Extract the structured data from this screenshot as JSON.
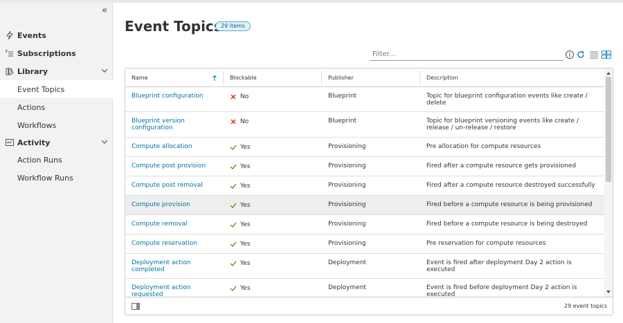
{
  "sidebar": {
    "collapse_label": "«",
    "items": [
      {
        "label": "Events",
        "icon": "bolt-icon",
        "type": "group"
      },
      {
        "label": "Subscriptions",
        "icon": "subscriptions-icon",
        "type": "group"
      },
      {
        "label": "Library",
        "icon": "library-icon",
        "type": "group",
        "expandable": true
      },
      {
        "label": "Event Topics",
        "type": "child",
        "active": true
      },
      {
        "label": "Actions",
        "type": "child"
      },
      {
        "label": "Workflows",
        "type": "child"
      },
      {
        "label": "Activity",
        "icon": "activity-icon",
        "type": "group",
        "expandable": true
      },
      {
        "label": "Action Runs",
        "type": "child"
      },
      {
        "label": "Workflow Runs",
        "type": "child"
      }
    ]
  },
  "header": {
    "title": "Event Topics",
    "badge": "29 items"
  },
  "filter": {
    "placeholder": "Filter..."
  },
  "grid": {
    "columns": [
      "Name",
      "Blockable",
      "Publisher",
      "Description"
    ],
    "rows": [
      {
        "name": "Blueprint configuration",
        "blockable": "No",
        "publisher": "Blueprint",
        "description": "Topic for blueprint configuration events like create / delete"
      },
      {
        "name": "Blueprint version configuration",
        "blockable": "No",
        "publisher": "Blueprint",
        "description": "Topic for blueprint versioning events like create / release / un-release / restore"
      },
      {
        "name": "Compute allocation",
        "blockable": "Yes",
        "publisher": "Provisioning",
        "description": "Pre allocation for compute resources"
      },
      {
        "name": "Compute post provision",
        "blockable": "Yes",
        "publisher": "Provisioning",
        "description": "Fired after a compute resource gets provisioned"
      },
      {
        "name": "Compute post removal",
        "blockable": "Yes",
        "publisher": "Provisioning",
        "description": "Fired after a compute resource destroyed successfully"
      },
      {
        "name": "Compute provision",
        "blockable": "Yes",
        "publisher": "Provisioning",
        "description": "Fired before a compute resource is being provisioned"
      },
      {
        "name": "Compute removal",
        "blockable": "Yes",
        "publisher": "Provisioning",
        "description": "Fired before a compute resource is being destroyed"
      },
      {
        "name": "Compute reservation",
        "blockable": "Yes",
        "publisher": "Provisioning",
        "description": "Pre reservation for compute resources"
      },
      {
        "name": "Deployment action completed",
        "blockable": "Yes",
        "publisher": "Deployment",
        "description": "Event is fired after deployment Day 2 action is executed"
      },
      {
        "name": "Deployment action requested",
        "blockable": "Yes",
        "publisher": "Deployment",
        "description": "Event is fired before deployment Day 2 action is executed"
      }
    ],
    "footer_count": "29 event topics"
  },
  "colors": {
    "link": "#0072a3",
    "yes_check": "#3c8500",
    "no_x": "#e12200",
    "accent": "#0079b8"
  }
}
